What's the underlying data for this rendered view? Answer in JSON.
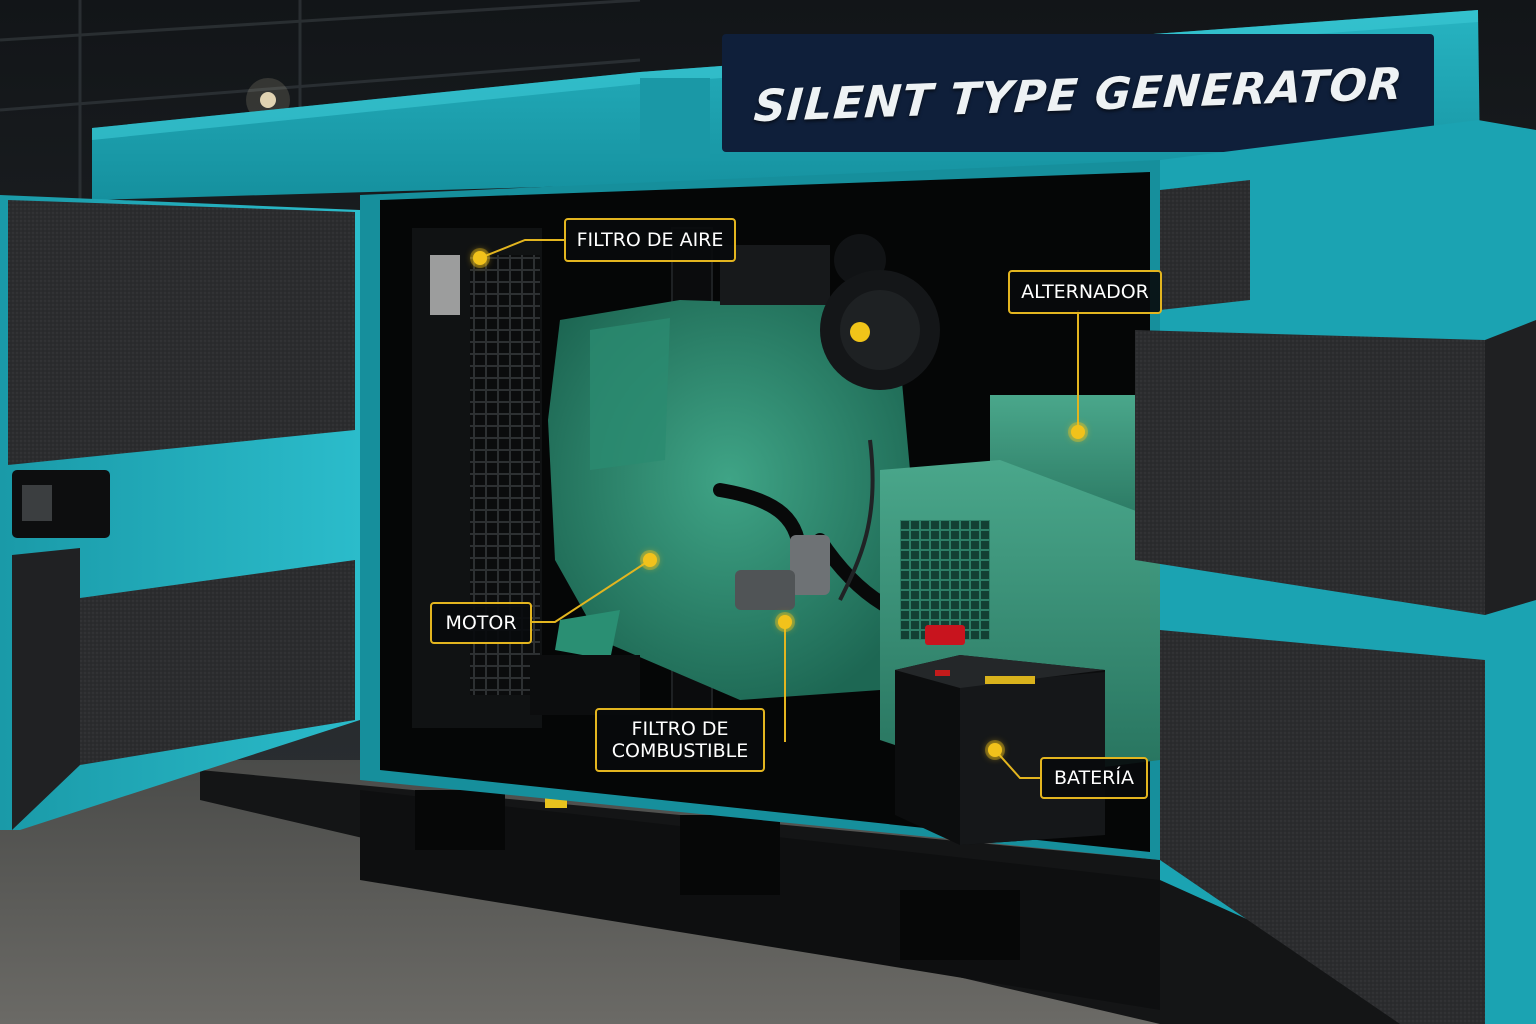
{
  "sign": {
    "text": "SILENT TYPE GENERATOR"
  },
  "labels": {
    "air_filter": "FILTRO DE AIRE",
    "alternator": "ALTERNADOR",
    "motor": "MOTOR",
    "fuel_filter_line1": "FILTRO DE",
    "fuel_filter_line2": "COMBUSTIBLE",
    "battery": "BATERÍA"
  },
  "colors": {
    "enclosure": "#1fa5b3",
    "engine": "#2e8a6e",
    "foam": "#2a2b2d",
    "callout": "#e3b51f",
    "sign_bg": "#0f1f3a"
  }
}
